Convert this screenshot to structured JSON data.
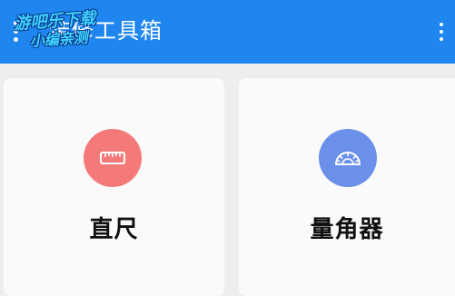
{
  "appbar": {
    "title": "装修工具箱",
    "background": "#1f86f0"
  },
  "watermark": {
    "line1": "游吧乐下载",
    "line2": "小编亲测"
  },
  "tools": [
    {
      "label": "直尺",
      "icon": "ruler-icon",
      "color": "#f47a7a"
    },
    {
      "label": "量角器",
      "icon": "protractor-icon",
      "color": "#6a90ea"
    }
  ]
}
